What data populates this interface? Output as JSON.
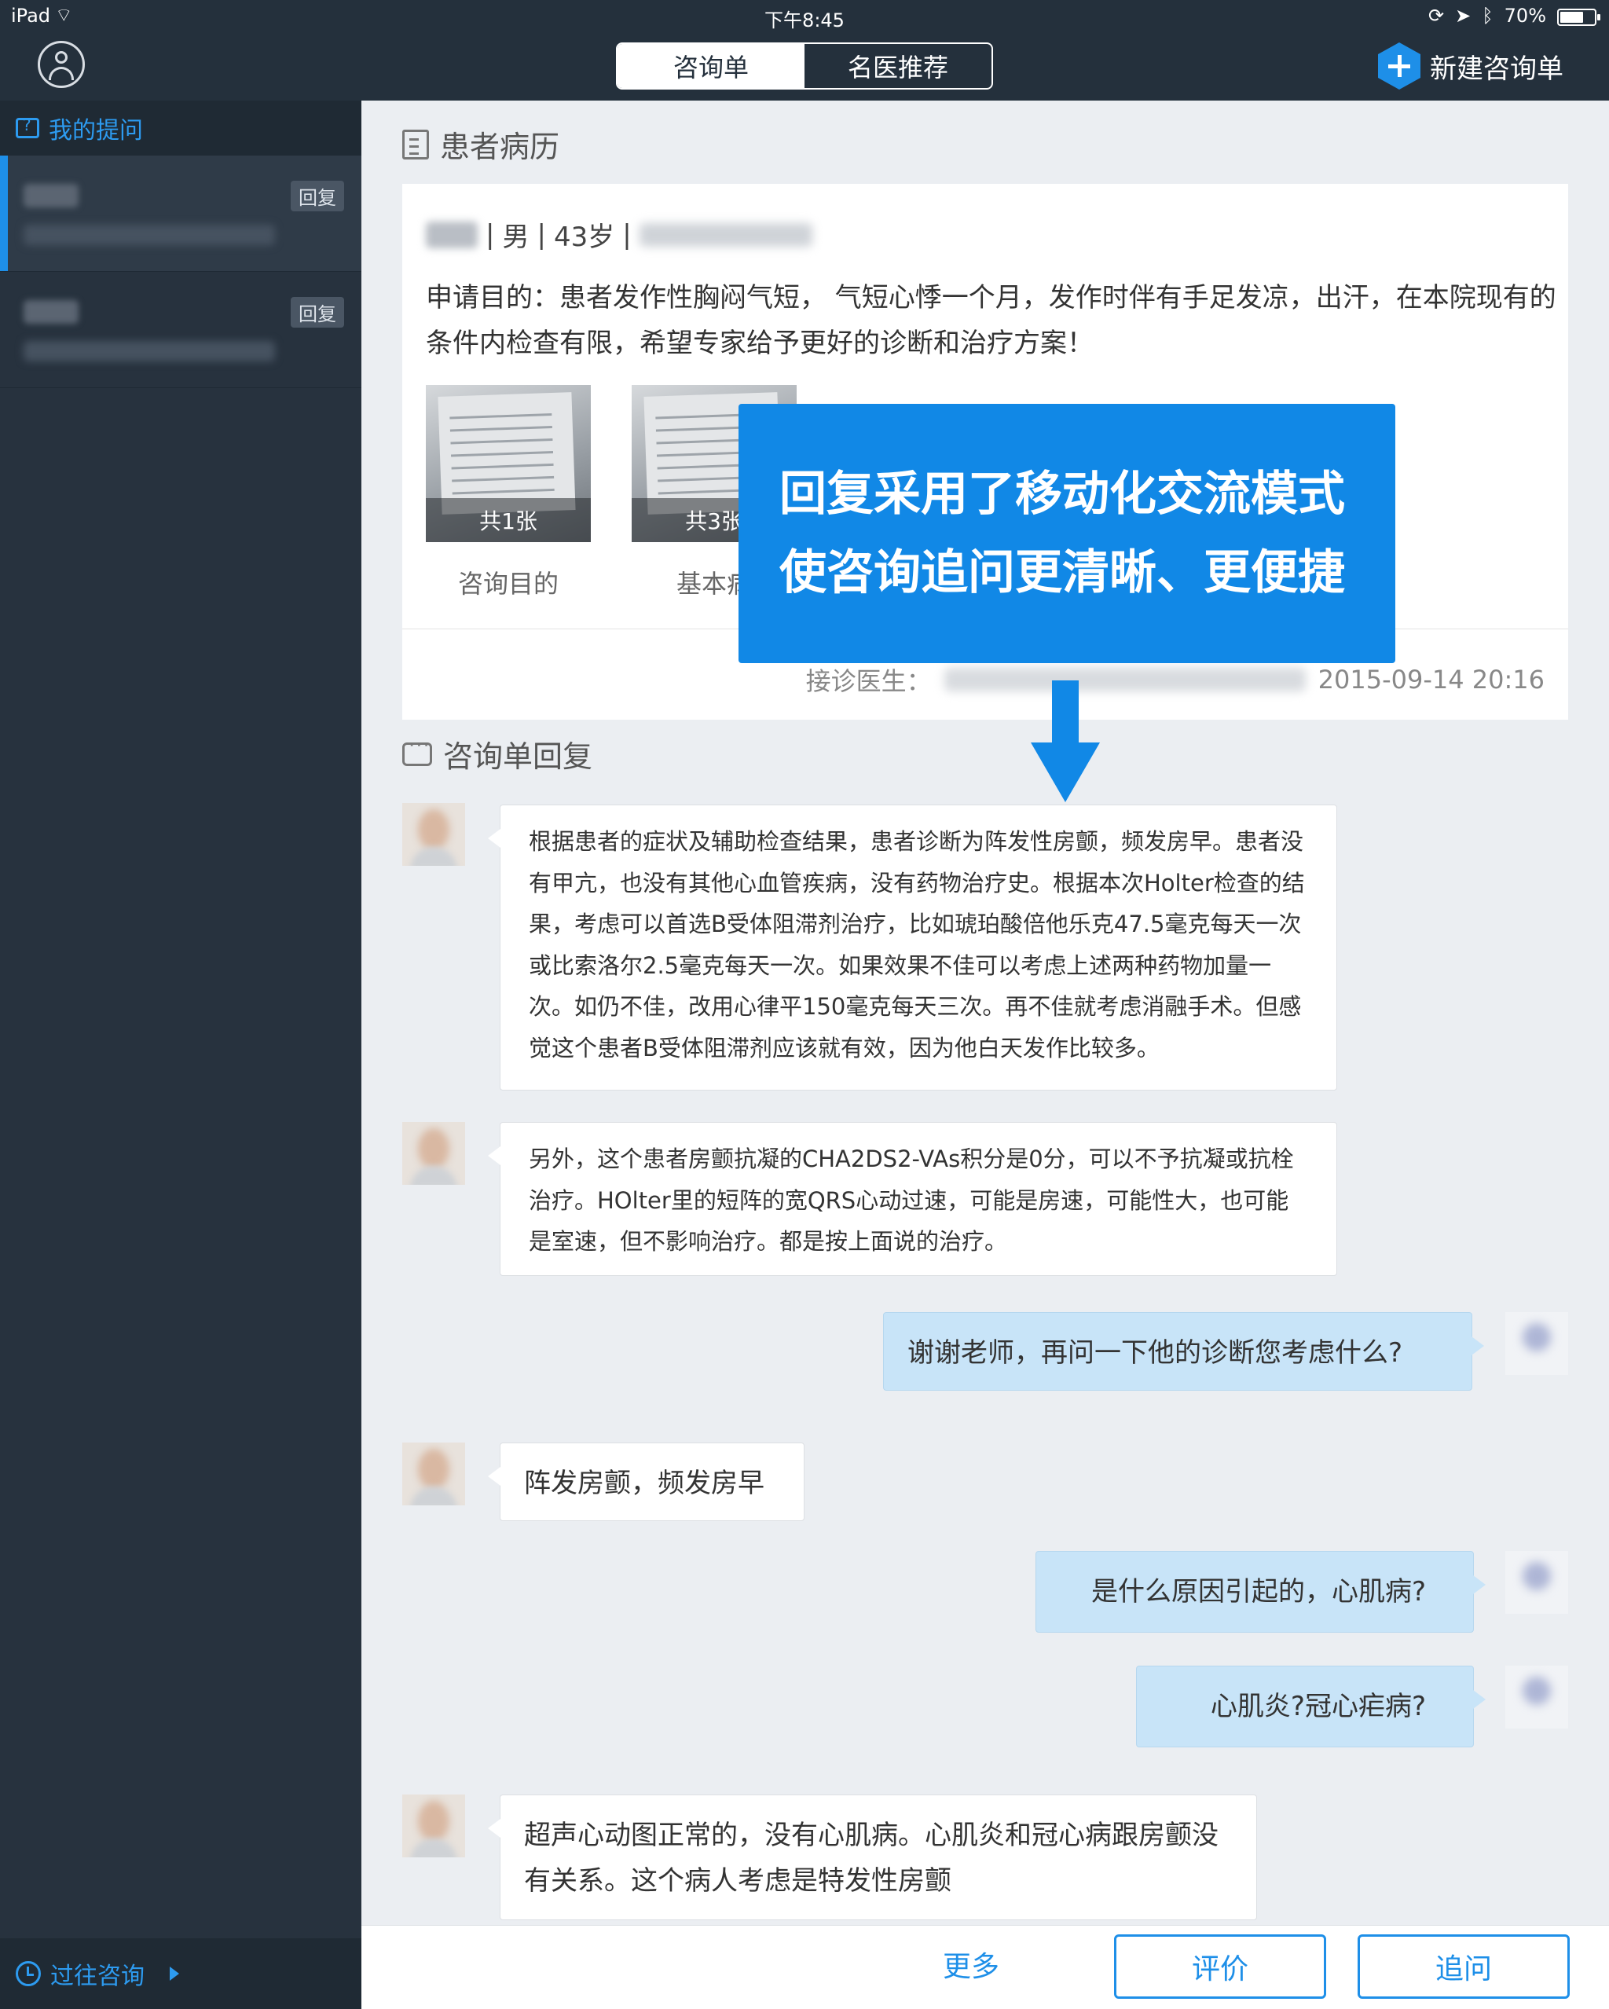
{
  "status_bar": {
    "device": "iPad",
    "time": "下午8:45",
    "battery": "70%",
    "battery_level": 0.7
  },
  "nav": {
    "tabs": [
      {
        "label": "咨询单",
        "active": true
      },
      {
        "label": "名医推荐",
        "active": false
      }
    ],
    "new_button": "新建咨询单"
  },
  "sidebar": {
    "header": "我的提问",
    "items": [
      {
        "reply_tag": "回复",
        "active": true
      },
      {
        "reply_tag": "回复",
        "active": false
      }
    ],
    "footer": "过往咨询"
  },
  "record": {
    "section_title": "患者病历",
    "gender": "男",
    "age": "43岁",
    "purpose": "申请目的：患者发作性胸闷气短， 气短心悸一个月，发作时伴有手足发凉，出汗，在本院现有的条件内检查有限，希望专家给予更好的诊断和治疗方案！",
    "attachments": [
      {
        "count": "共1张",
        "label": "咨询目的"
      },
      {
        "count": "共3张",
        "label": "基本病"
      }
    ],
    "doctor_label": "接诊医生：",
    "datetime": "2015-09-14 20:16"
  },
  "replies": {
    "section_title": "咨询单回复",
    "messages": [
      {
        "from": "doctor",
        "text": "根据患者的症状及辅助检查结果，患者诊断为阵发性房颤，频发房早。患者没有甲亢，也没有其他心血管疾病，没有药物治疗史。根据本次Holter检查的结果，考虑可以首选B受体阻滞剂治疗，比如琥珀酸倍他乐克47.5毫克每天一次或比索洛尔2.5毫克每天一次。如果效果不佳可以考虑上述两种药物加量一次。如仍不佳，改用心律平150毫克每天三次。再不佳就考虑消融手术。但感觉这个患者B受体阻滞剂应该就有效，因为他白天发作比较多。"
      },
      {
        "from": "doctor",
        "text": "另外，这个患者房颤抗凝的CHA2DS2-VAs积分是0分，可以不予抗凝或抗栓治疗。HOlter里的短阵的宽QRS心动过速，可能是房速，可能性大，也可能是室速，但不影响治疗。都是按上面说的治疗。"
      },
      {
        "from": "patient",
        "text": "谢谢老师，再问一下他的诊断您考虑什么?"
      },
      {
        "from": "doctor",
        "text": "阵发房颤，频发房早"
      },
      {
        "from": "patient",
        "text": "是什么原因引起的，心肌病?"
      },
      {
        "from": "patient",
        "text": "心肌炎?冠心疟病?"
      },
      {
        "from": "doctor",
        "text": "超声心动图正常的，没有心肌病。心肌炎和冠心病跟房颤没有关系。这个病人考虑是特发性房颤"
      }
    ]
  },
  "callout": {
    "line1": "回复采用了移动化交流模式",
    "line2": "使咨询追问更清晰、更便捷"
  },
  "bottom_bar": {
    "more": "更多",
    "rate": "评价",
    "follow_up": "追问"
  },
  "colors": {
    "accent": "#1e8fe8",
    "nav_bg": "#24303c",
    "sidebar_bg": "#27323e",
    "patient_bubble": "#c8e4f8"
  }
}
